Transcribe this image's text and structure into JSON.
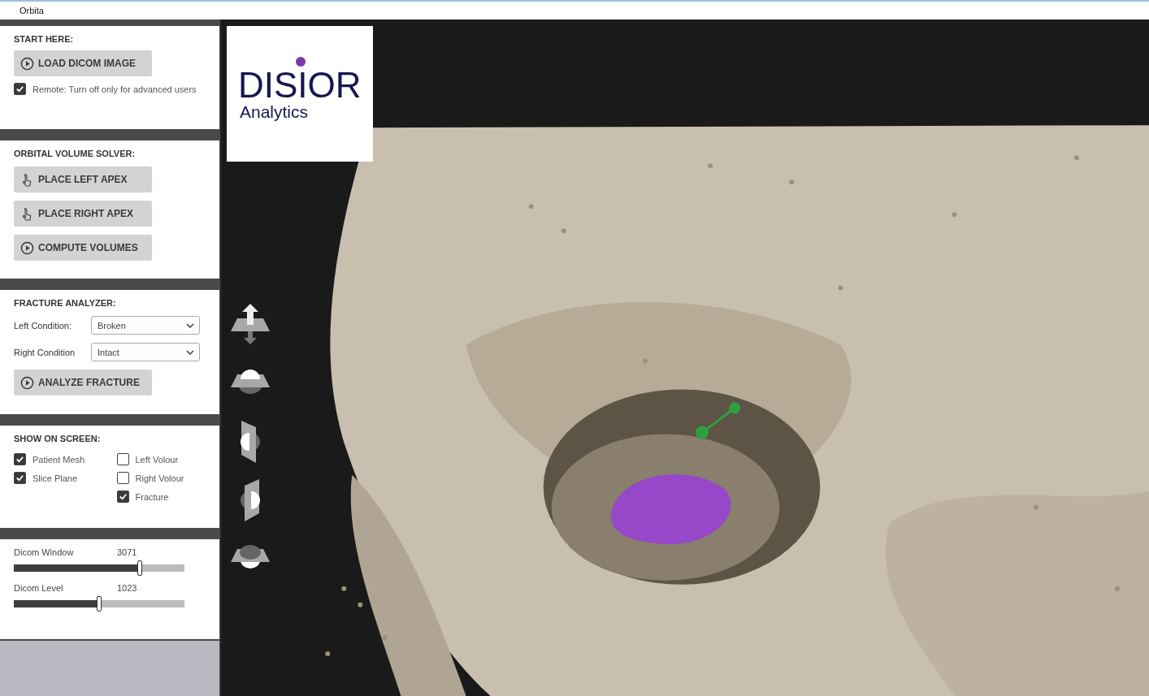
{
  "window": {
    "title": "Orbita"
  },
  "sidebar": {
    "sections": [
      {
        "title": "START HERE:",
        "items": [
          {
            "kind": "action",
            "label": "LOAD DICOM IMAGE"
          },
          {
            "kind": "checkbox",
            "label": "Remote: Turn off only for advanced users",
            "checked": true
          }
        ]
      },
      {
        "title": "ORBITAL VOLUME SOLVER:",
        "items": [
          {
            "kind": "pick",
            "label": "PLACE LEFT APEX"
          },
          {
            "kind": "pick",
            "label": "PLACE RIGHT APEX"
          },
          {
            "kind": "action",
            "label": "COMPUTE VOLUMES"
          }
        ]
      },
      {
        "title": "FRACTURE ANALYZER:",
        "items": [
          {
            "kind": "select",
            "label": "Left Condition:",
            "value": "Broken"
          },
          {
            "kind": "select",
            "label": "Right Condition",
            "value": "Intact"
          },
          {
            "kind": "action",
            "label": "ANALYZE FRACTURE"
          }
        ]
      },
      {
        "title": "SHOW ON SCREEN:",
        "items": [
          {
            "kind": "checkgrid",
            "columns": [
              [
                {
                  "label": "Patient Mesh",
                  "checked": true
                },
                {
                  "label": "Slice Plane",
                  "checked": true
                }
              ],
              [
                {
                  "label": "Left Volour",
                  "checked": false
                },
                {
                  "label": "Right Volour",
                  "checked": false
                },
                {
                  "label": "Fracture",
                  "checked": true
                }
              ]
            ]
          }
        ]
      },
      {
        "items": [
          {
            "kind": "slider",
            "label": "Dicom Window",
            "reading": "3071",
            "level": 0.74
          },
          {
            "kind": "slider",
            "label": "Dicom Level",
            "reading": "1023",
            "level": 0.5
          }
        ]
      }
    ]
  },
  "viewport": {
    "logo": {
      "name": "DISIOR",
      "subtitle": "Analytics"
    }
  }
}
